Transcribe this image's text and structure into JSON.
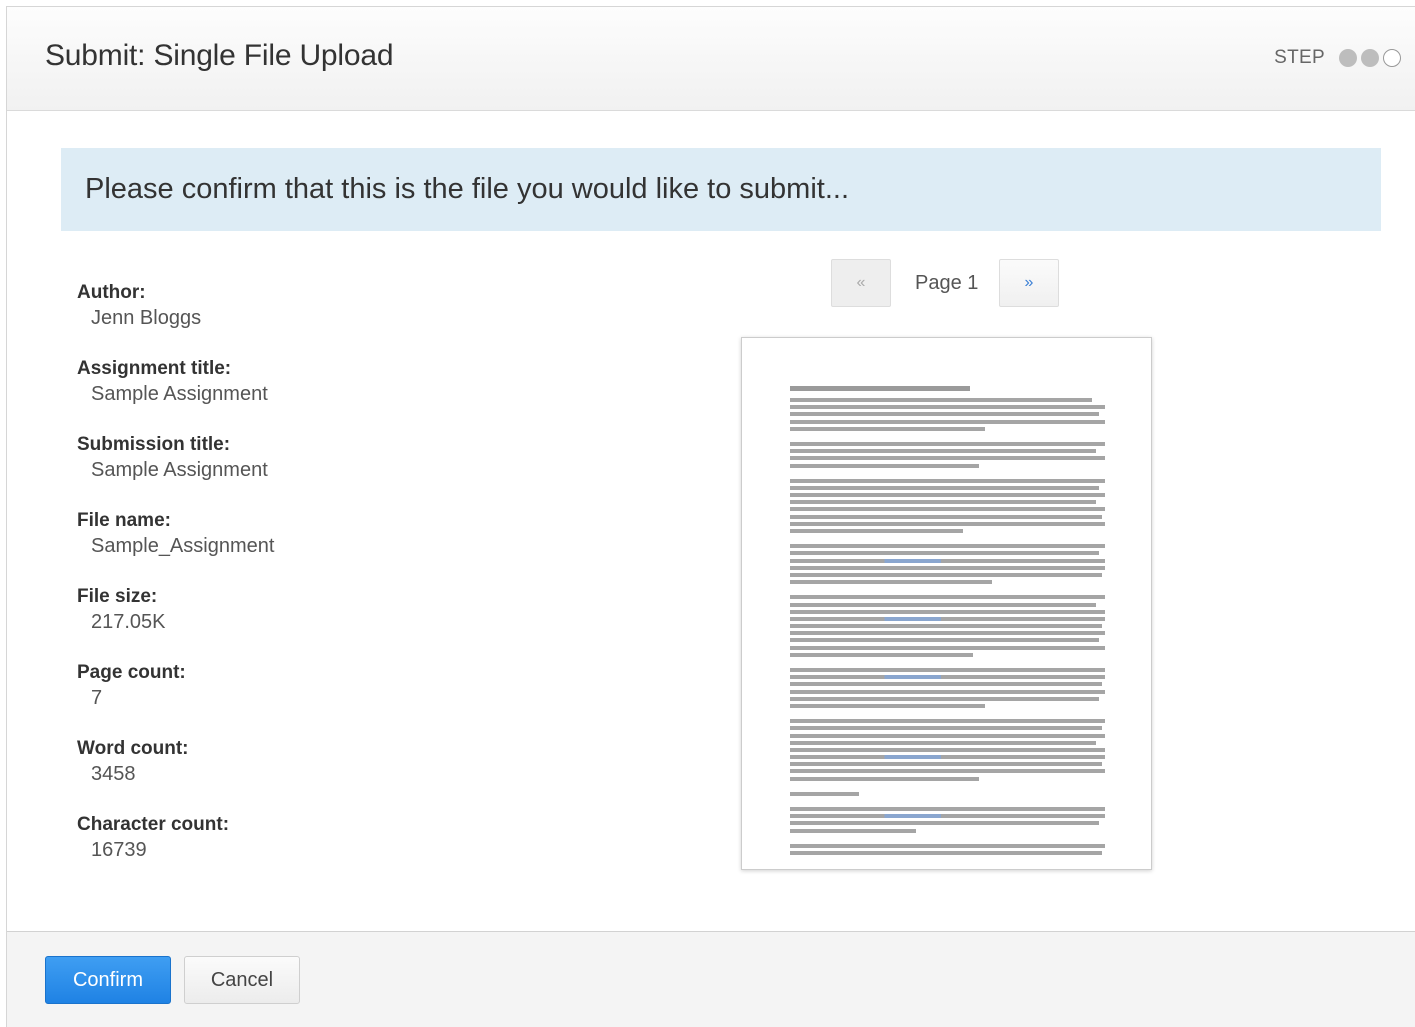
{
  "header": {
    "title": "Submit: Single File Upload",
    "step_label": "STEP"
  },
  "steps": [
    {
      "state": "done"
    },
    {
      "state": "done"
    },
    {
      "state": "current"
    }
  ],
  "notice": {
    "text": "Please confirm that this is the file you would like to submit..."
  },
  "details": [
    {
      "label": "Author:",
      "value": "Jenn Bloggs"
    },
    {
      "label": "Assignment title:",
      "value": "Sample Assignment"
    },
    {
      "label": "Submission title:",
      "value": "Sample Assignment"
    },
    {
      "label": "File name:",
      "value": "Sample_Assignment"
    },
    {
      "label": "File size:",
      "value": "217.05K"
    },
    {
      "label": "Page count:",
      "value": "7"
    },
    {
      "label": "Word count:",
      "value": "3458"
    },
    {
      "label": "Character count:",
      "value": "16739"
    }
  ],
  "pager": {
    "prev_label": "«",
    "next_label": "»",
    "page_label": "Page 1"
  },
  "footer": {
    "confirm_label": "Confirm",
    "cancel_label": "Cancel"
  },
  "colors": {
    "primary": "#2a8be8",
    "notice_bg": "#ddecf5",
    "link": "#3a7fd5"
  }
}
